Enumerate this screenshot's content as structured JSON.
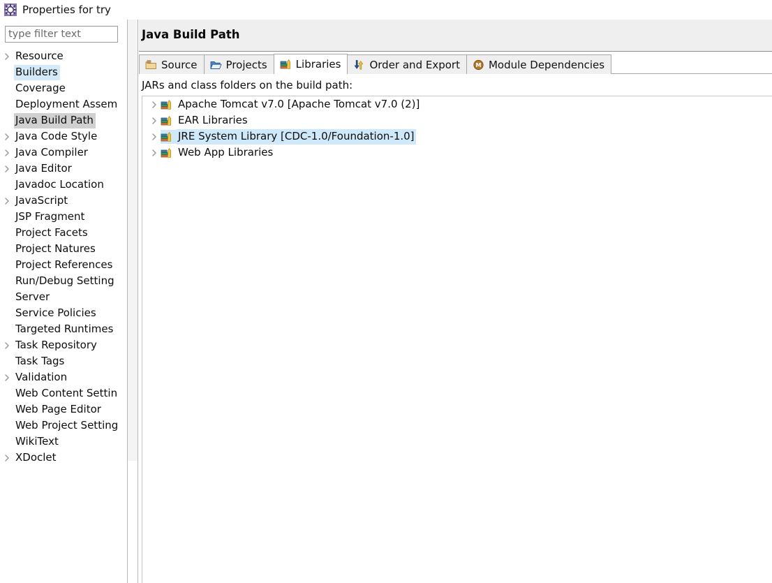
{
  "dialog": {
    "title": "Properties for try",
    "icon": "gear-icon"
  },
  "sidebar": {
    "filter": {
      "placeholder": "type filter text",
      "value": ""
    },
    "items": [
      {
        "label": "Resource",
        "expandable": true,
        "state": "normal"
      },
      {
        "label": "Builders",
        "expandable": false,
        "state": "hovered"
      },
      {
        "label": "Coverage",
        "expandable": false,
        "state": "normal"
      },
      {
        "label": "Deployment Assem",
        "expandable": false,
        "state": "normal"
      },
      {
        "label": "Java Build Path",
        "expandable": false,
        "state": "selected"
      },
      {
        "label": "Java Code Style",
        "expandable": true,
        "state": "normal"
      },
      {
        "label": "Java Compiler",
        "expandable": true,
        "state": "normal"
      },
      {
        "label": "Java Editor",
        "expandable": true,
        "state": "normal"
      },
      {
        "label": "Javadoc Location",
        "expandable": false,
        "state": "normal"
      },
      {
        "label": "JavaScript",
        "expandable": true,
        "state": "normal"
      },
      {
        "label": "JSP Fragment",
        "expandable": false,
        "state": "normal"
      },
      {
        "label": "Project Facets",
        "expandable": false,
        "state": "normal"
      },
      {
        "label": "Project Natures",
        "expandable": false,
        "state": "normal"
      },
      {
        "label": "Project References",
        "expandable": false,
        "state": "normal"
      },
      {
        "label": "Run/Debug Setting",
        "expandable": false,
        "state": "normal"
      },
      {
        "label": "Server",
        "expandable": false,
        "state": "normal"
      },
      {
        "label": "Service Policies",
        "expandable": false,
        "state": "normal"
      },
      {
        "label": "Targeted Runtimes",
        "expandable": false,
        "state": "normal"
      },
      {
        "label": "Task Repository",
        "expandable": true,
        "state": "normal"
      },
      {
        "label": "Task Tags",
        "expandable": false,
        "state": "normal"
      },
      {
        "label": "Validation",
        "expandable": true,
        "state": "normal"
      },
      {
        "label": "Web Content Settin",
        "expandable": false,
        "state": "normal"
      },
      {
        "label": "Web Page Editor",
        "expandable": false,
        "state": "normal"
      },
      {
        "label": "Web Project Setting",
        "expandable": false,
        "state": "normal"
      },
      {
        "label": "WikiText",
        "expandable": false,
        "state": "normal"
      },
      {
        "label": "XDoclet",
        "expandable": true,
        "state": "normal"
      }
    ]
  },
  "page": {
    "title": "Java Build Path",
    "tabs": [
      {
        "label": "Source",
        "icon": "source-folder-icon",
        "active": false
      },
      {
        "label": "Projects",
        "icon": "open-folder-icon",
        "active": false
      },
      {
        "label": "Libraries",
        "icon": "books-icon",
        "active": true
      },
      {
        "label": "Order and Export",
        "icon": "updown-arrows-icon",
        "active": false
      },
      {
        "label": "Module Dependencies",
        "icon": "module-circle-icon",
        "active": false
      }
    ],
    "list_caption": "JARs and class folders on the build path:",
    "libraries": [
      {
        "label": "Apache Tomcat v7.0 [Apache Tomcat v7.0 (2)]",
        "icon": "books-icon",
        "selected": false
      },
      {
        "label": "EAR Libraries",
        "icon": "books-icon",
        "selected": false
      },
      {
        "label": "JRE System Library [CDC-1.0/Foundation-1.0]",
        "icon": "books-icon",
        "selected": true
      },
      {
        "label": "Web App Libraries",
        "icon": "books-icon",
        "selected": false
      }
    ]
  },
  "colors": {
    "selection_blue": "#cfe8fa",
    "selection_gray": "#d0d0d0",
    "hover_blue": "#d5eaf8",
    "header_bg": "#efefef",
    "border": "#a8a8a8"
  }
}
